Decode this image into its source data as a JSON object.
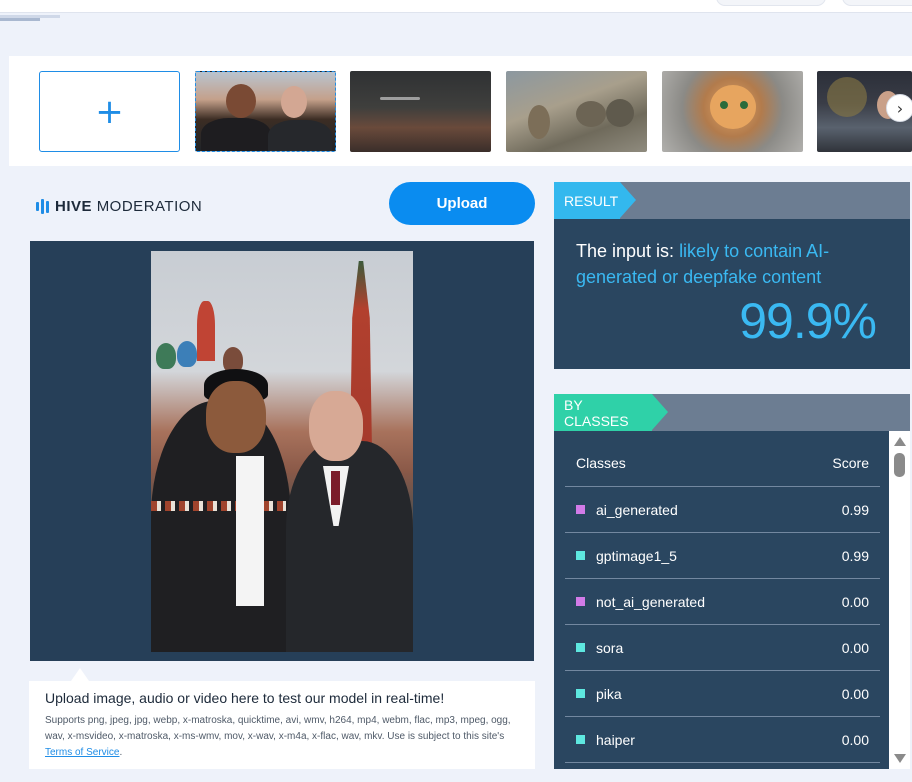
{
  "gallery": {
    "add_label": "+",
    "thumbnails": [
      {
        "name": "morales-putin-photo",
        "selected": true
      },
      {
        "name": "aircraft-over-hills-photo",
        "selected": false
      },
      {
        "name": "elephants-painting-photo",
        "selected": false
      },
      {
        "name": "cat-in-hoodie-photo",
        "selected": false
      },
      {
        "name": "press-conference-photo",
        "selected": false
      }
    ],
    "next_icon": "›"
  },
  "brand": {
    "bold": "HIVE",
    "light": "MODERATION",
    "accent_color": "#1f8de6"
  },
  "upload": {
    "button_label": "Upload"
  },
  "info": {
    "heading": "Upload image, audio or video here to test our model in real-time!",
    "supports_text": "Supports png, jpeg, jpg, webp, x-matroska, quicktime, avi, wmv, h264, mp4, webm, flac, mp3, mpeg, ogg, wav, x-msvideo, x-matroska, x-ms-wmv, mov, x-wav, x-m4a, x-flac, wav, mkv. Use is subject to this site's ",
    "tos_link": "Terms of Service",
    "tos_suffix": "."
  },
  "result": {
    "tag": "RESULT",
    "prefix": "The input is: ",
    "verdict": "likely to contain AI-generated or deepfake content",
    "percentage": "99.9%",
    "tag_color": "#33b8ee"
  },
  "by_classes": {
    "tag": "BY CLASSES",
    "tag_color": "#2fd1a8",
    "col_classes": "Classes",
    "col_score": "Score",
    "rows": [
      {
        "label": "ai_generated",
        "score": "0.99",
        "color": "#d27be8"
      },
      {
        "label": "gptimage1_5",
        "score": "0.99",
        "color": "#5ee8e0"
      },
      {
        "label": "not_ai_generated",
        "score": "0.00",
        "color": "#d27be8"
      },
      {
        "label": "sora",
        "score": "0.00",
        "color": "#5ee8e0"
      },
      {
        "label": "pika",
        "score": "0.00",
        "color": "#5ee8e0"
      },
      {
        "label": "haiper",
        "score": "0.00",
        "color": "#5ee8e0"
      }
    ]
  }
}
